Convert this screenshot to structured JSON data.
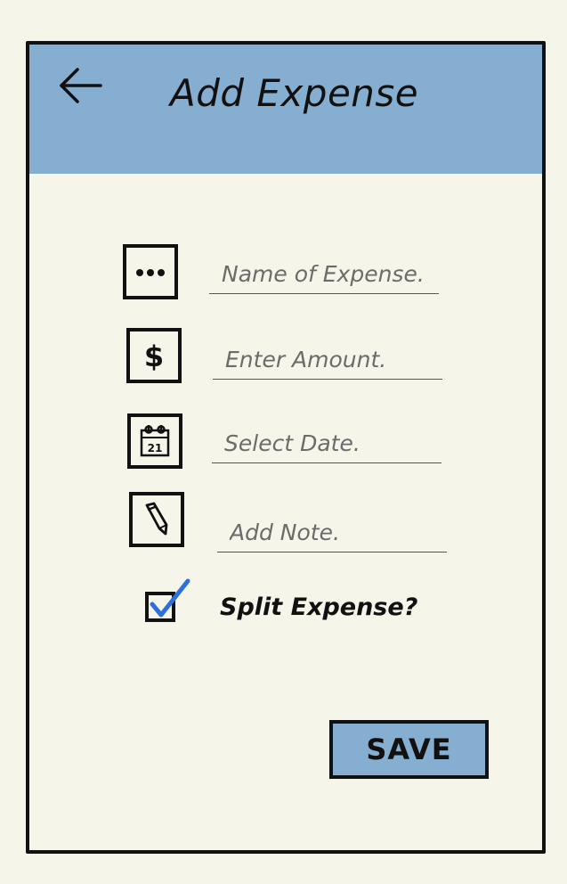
{
  "header": {
    "title": "Add Expense",
    "back_icon": "arrow-left-icon",
    "color": "#86aed1"
  },
  "form": {
    "fields": [
      {
        "icon": "more-dots-icon",
        "placeholder": "Name of Expense.",
        "value": ""
      },
      {
        "icon": "dollar-icon",
        "placeholder": "Enter Amount.",
        "value": ""
      },
      {
        "icon": "calendar-icon",
        "placeholder": "Select Date.",
        "value": "",
        "calendar_day": "21"
      },
      {
        "icon": "pencil-icon",
        "placeholder": "Add Note.",
        "value": ""
      }
    ],
    "split": {
      "label": "Split Expense?",
      "checked": true,
      "check_color": "#2e6fe0"
    },
    "save_label": "SAVE"
  },
  "colors": {
    "background": "#f6f5ea",
    "accent": "#86aed1",
    "border": "#111111"
  }
}
